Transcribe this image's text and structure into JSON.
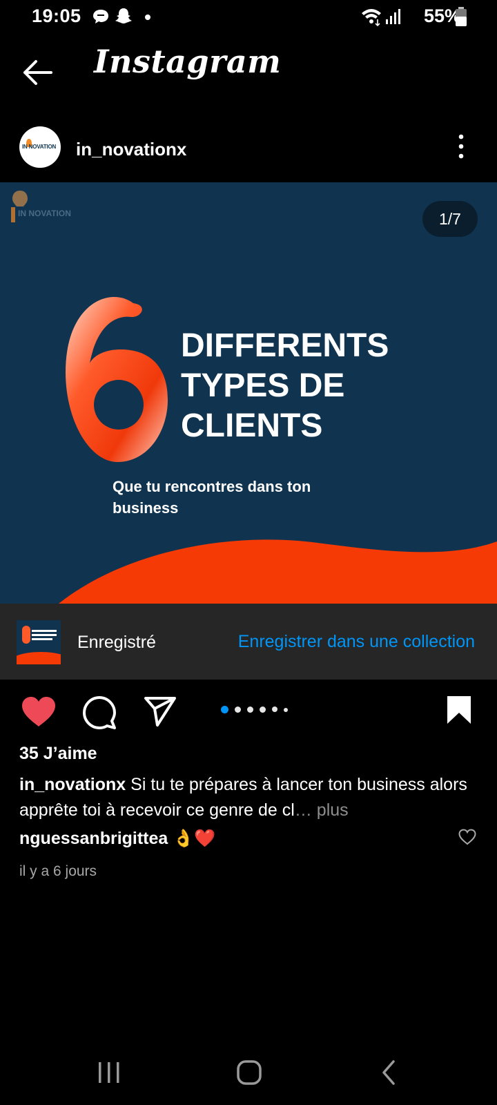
{
  "status": {
    "time": "19:05",
    "battery": "55%",
    "icons": [
      "message-icon",
      "snapchat-icon",
      "notification-dot",
      "wifi-icon",
      "signal-icon",
      "battery-icon"
    ]
  },
  "header": {
    "title": "Instagram",
    "back_icon": "arrow-left-icon"
  },
  "post": {
    "username": "in_novationx",
    "avatar_text": "IN NOVATION",
    "page_counter": "1/7",
    "image": {
      "logo_text": "IN NOVATION",
      "big_number": "6",
      "headline": "DIFFERENTS TYPES DE CLIENTS",
      "sub": "Que tu rencontres dans ton business",
      "colors": {
        "bg": "#10344f",
        "accent": "#f0390b"
      }
    },
    "save_bar": {
      "saved_label": "Enregistré",
      "collection_link": "Enregistrer dans une collection"
    },
    "carousel": {
      "count": 6,
      "active": 0
    },
    "liked": true,
    "bookmarked": true,
    "likes": "35 J’aime",
    "caption": {
      "username": "in_novationx",
      "text": "Si tu te prépares à lancer ton business alors apprête toi à recevoir ce genre de cl",
      "ellipsis": "…",
      "more": "plus"
    },
    "comment": {
      "username": "nguessanbrigittea",
      "emoji": "👌❤️"
    },
    "timestamp": "il y a 6 jours"
  },
  "navbar": {
    "icons": [
      "recent-apps-icon",
      "home-icon",
      "back-icon"
    ]
  },
  "colors": {
    "link": "#0095f6",
    "like": "#ed4956"
  }
}
